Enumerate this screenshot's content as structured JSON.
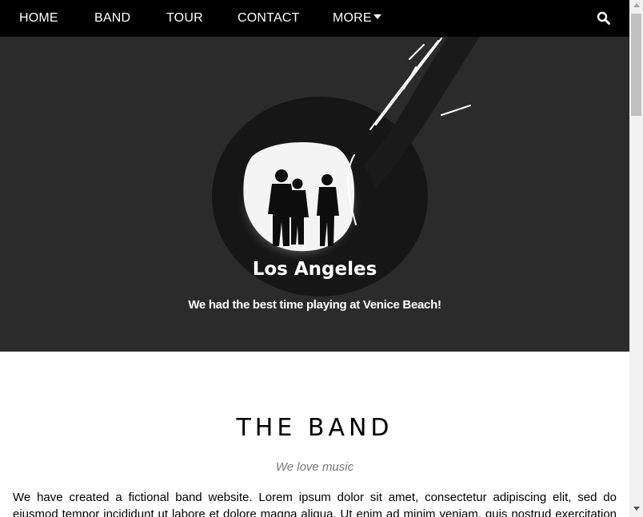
{
  "nav": {
    "items": [
      {
        "label": "HOME"
      },
      {
        "label": "BAND"
      },
      {
        "label": "TOUR"
      },
      {
        "label": "CONTACT"
      },
      {
        "label": "MORE"
      }
    ],
    "search_icon": "search-icon",
    "more_icon": "caret-down-icon"
  },
  "hero": {
    "title": "Los Angeles",
    "subtitle": "We had the best time playing at Venice Beach!"
  },
  "band": {
    "title": "THE BAND",
    "subtitle": "We love music",
    "text": "We have created a fictional band website. Lorem ipsum dolor sit amet, consectetur adipiscing elit, sed do eiusmod tempor incididunt ut labore et dolore magna aliqua. Ut enim ad minim veniam, quis nostrud exercitation ullamco"
  },
  "colors": {
    "navbar": "#000000",
    "hero_background": "#2b2b2b",
    "subtitle_gray": "#777777"
  }
}
